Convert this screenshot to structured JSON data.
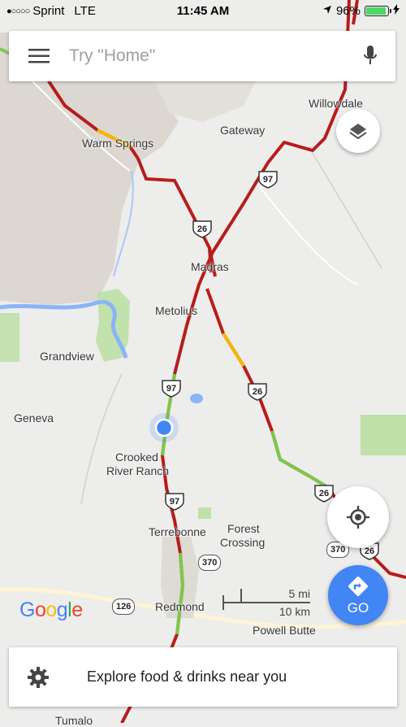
{
  "status_bar": {
    "carrier": "Sprint",
    "network": "LTE",
    "time": "11:45 AM",
    "battery_percent": "96%",
    "battery_level": 0.96
  },
  "search": {
    "placeholder": "Try \"Home\""
  },
  "map": {
    "places": {
      "willowdale": "Willowdale",
      "gateway": "Gateway",
      "warm_springs": "Warm Springs",
      "madras": "Madras",
      "metolius": "Metolius",
      "grandview": "Grandview",
      "geneva": "Geneva",
      "crooked_river_ranch_1": "Crooked",
      "crooked_river_ranch_2": "River Ranch",
      "terrebonne": "Terrebonne",
      "forest_crossing_1": "Forest",
      "forest_crossing_2": "Crossing",
      "redmond": "Redmond",
      "powell_butte": "Powell Butte",
      "tumalo": "Tumalo"
    },
    "shields": {
      "us97_a": "97",
      "us26_a": "26",
      "us97_b": "97",
      "us26_b": "26",
      "us97_c": "97",
      "us26_c": "26",
      "us26_d": "26",
      "or370_a": "370",
      "or370_b": "370",
      "or126": "126"
    },
    "scale": {
      "miles": "5 mi",
      "km": "10 km"
    },
    "logo": "Google",
    "colors": {
      "traffic_red": "#b71c1c",
      "traffic_green": "#7cc94a",
      "traffic_yellow": "#f5b800",
      "location_blue": "#4285f4"
    }
  },
  "go_button": {
    "label": "GO"
  },
  "explore": {
    "label": "Explore food & drinks near you"
  }
}
